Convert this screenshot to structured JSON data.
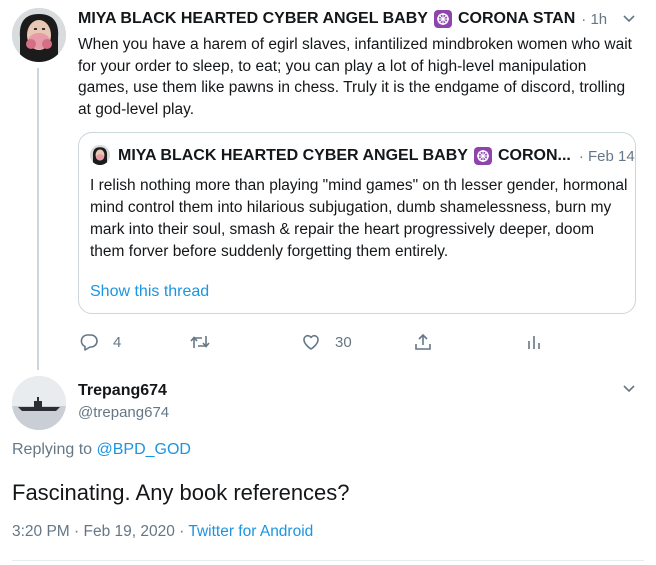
{
  "tweet": {
    "display_name": "MIYA BLACK HEARTED CYBER ANGEL BABY",
    "display_name_suffix": "CORONA STAN",
    "time": "· 1h",
    "text": "When you have a harem of egirl slaves, infantilized mindbroken women who wait for your order to sleep, to eat; you can play a lot of high-level manipulation games, use them like pawns in chess. Truly it is the endgame of discord, trolling at god-level play.",
    "quote": {
      "display_name": "MIYA BLACK HEARTED CYBER ANGEL BABY",
      "display_name_suffix": "CORON...",
      "time": "· Feb 14",
      "text": "I relish nothing more than playing \"mind games\" on th lesser gender, hormonal mind control them into hilarious subjugation, dumb shamelessness, burn my mark into their soul, smash & repair the heart progressively deeper, doom them forver before suddenly forgetting them entirely.",
      "show_thread": "Show this thread"
    },
    "actions": {
      "reply_count": "4",
      "retweet_count": "",
      "like_count": "30"
    }
  },
  "reply": {
    "display_name": "Trepang674",
    "handle": "@trepang674",
    "replying_prefix": "Replying to",
    "replying_to": "@BPD_GOD",
    "text": "Fascinating. Any book references?",
    "timestamp": "3:20 PM · Feb 19, 2020 ·",
    "source": "Twitter for Android"
  },
  "colors": {
    "link": "#1b95e0",
    "muted": "#657786",
    "emblem": "#8e44ad",
    "border": "#ccd6dd"
  }
}
